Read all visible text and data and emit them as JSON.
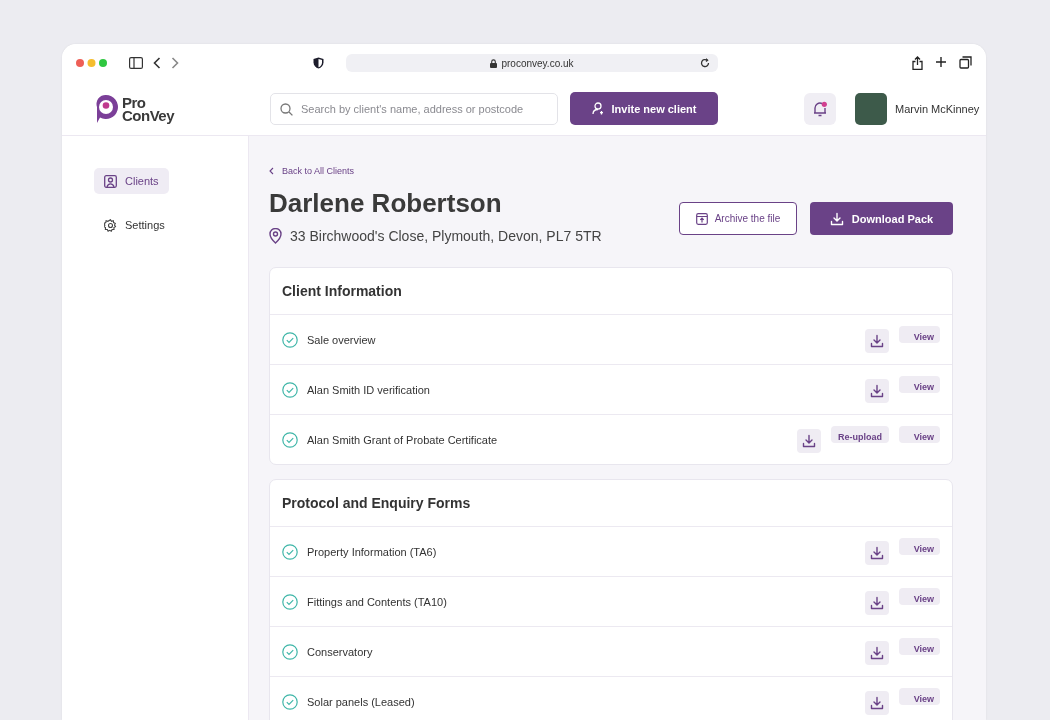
{
  "browser": {
    "url": "proconvey.co.uk"
  },
  "header": {
    "logo_line1": "Pro",
    "logo_line2": "ConVey",
    "search": {
      "placeholder": "Search by client's name, address or postcode"
    },
    "invite_button": "Invite new client",
    "notifications": {
      "unread": true
    },
    "user": {
      "name": "Marvin McKinney"
    }
  },
  "sidebar": {
    "items": [
      {
        "label": "Clients",
        "kind": "person",
        "selected": true
      },
      {
        "label": "Settings",
        "kind": "gear",
        "selected": false
      }
    ]
  },
  "page": {
    "back_link": "Back to All Clients",
    "title": "Darlene Robertson",
    "address": "33 Birchwood's Close, Plymouth, Devon, PL7 5TR",
    "archive_button": "Archive the file",
    "download_button": "Download Pack"
  },
  "sections": [
    {
      "title": "Client Information",
      "rows": [
        {
          "label": "Sale overview",
          "checked": true,
          "actions": [
            {
              "kind": "download"
            },
            {
              "kind": "view",
              "label": "View"
            }
          ]
        },
        {
          "label": "Alan Smith ID verification",
          "checked": true,
          "actions": [
            {
              "kind": "download"
            },
            {
              "kind": "view",
              "label": "View"
            }
          ]
        },
        {
          "label": "Alan Smith Grant of Probate Certificate",
          "checked": true,
          "actions": [
            {
              "kind": "download"
            },
            {
              "kind": "reupload",
              "label": "Re-upload"
            },
            {
              "kind": "view",
              "label": "View"
            }
          ]
        }
      ]
    },
    {
      "title": "Protocol and Enquiry Forms",
      "rows": [
        {
          "label": "Property Information (TA6)",
          "checked": true,
          "actions": [
            {
              "kind": "download"
            },
            {
              "kind": "view",
              "label": "View"
            }
          ]
        },
        {
          "label": "Fittings and Contents (TA10)",
          "checked": true,
          "actions": [
            {
              "kind": "download"
            },
            {
              "kind": "view",
              "label": "View"
            }
          ]
        },
        {
          "label": "Conservatory",
          "checked": true,
          "actions": [
            {
              "kind": "download"
            },
            {
              "kind": "view",
              "label": "View"
            }
          ]
        },
        {
          "label": "Solar panels (Leased)",
          "checked": true,
          "actions": [
            {
              "kind": "download"
            },
            {
              "kind": "view",
              "label": "View"
            }
          ]
        }
      ]
    }
  ]
}
